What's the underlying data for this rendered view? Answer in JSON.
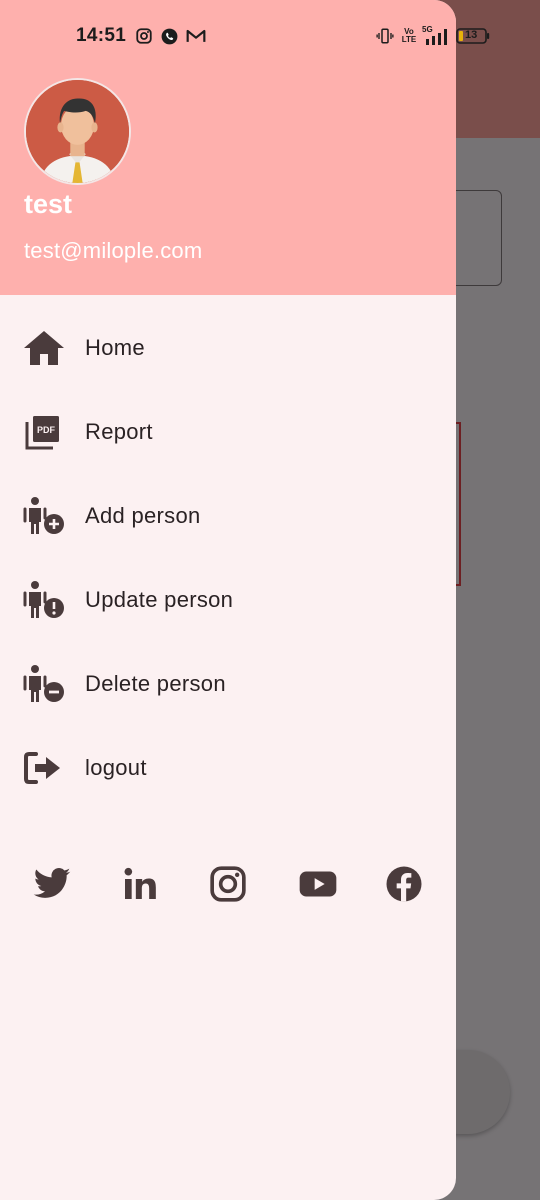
{
  "status_bar": {
    "time": "14:51",
    "battery_level": "13",
    "network": "5G",
    "volte": "Vo LTE"
  },
  "drawer": {
    "user": {
      "name": "test",
      "email": "test@milople.com"
    },
    "menu": [
      {
        "label": "Home",
        "icon": "home-icon"
      },
      {
        "label": "Report",
        "icon": "pdf-icon"
      },
      {
        "label": "Add person",
        "icon": "person-add-icon"
      },
      {
        "label": "Update person",
        "icon": "person-alert-icon"
      },
      {
        "label": "Delete person",
        "icon": "person-remove-icon"
      },
      {
        "label": "logout",
        "icon": "logout-icon"
      }
    ],
    "social": [
      {
        "name": "twitter-icon"
      },
      {
        "name": "linkedin-icon"
      },
      {
        "name": "instagram-icon"
      },
      {
        "name": "youtube-icon"
      },
      {
        "name": "facebook-icon"
      }
    ]
  },
  "colors": {
    "header": "#feb0ad",
    "drawer_bg": "#fcf1f2",
    "icon": "#4a3b3c",
    "scrim": "#767375"
  }
}
